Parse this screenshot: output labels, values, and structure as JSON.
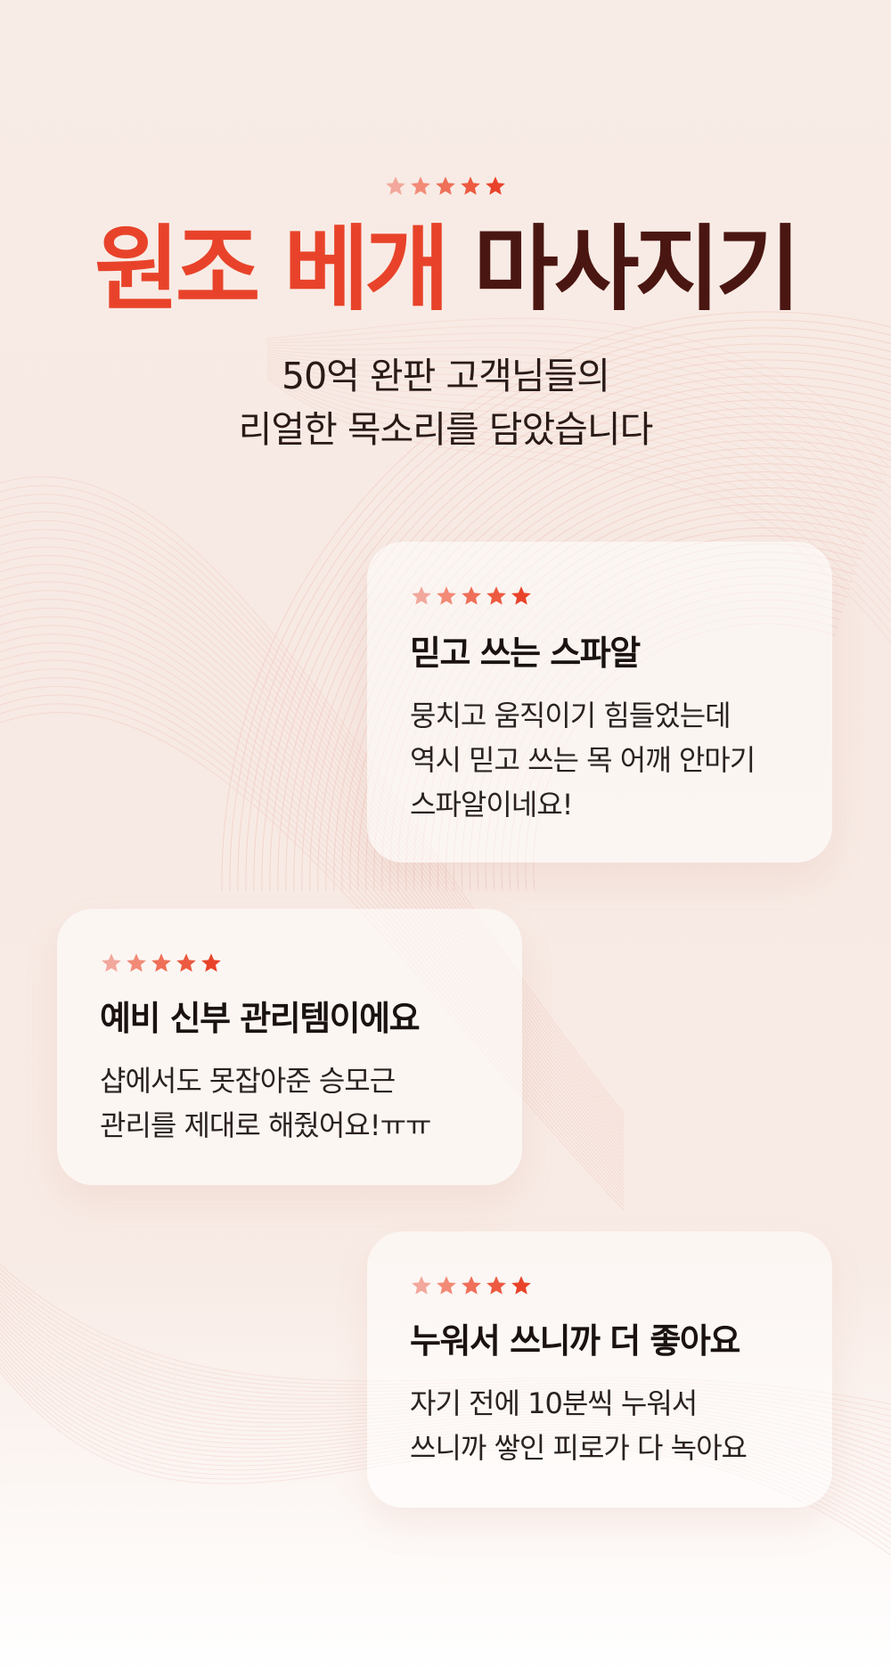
{
  "hero": {
    "headline_accent": "원조 베개",
    "headline_main": "마사지기",
    "subhead_line1": "50억 완판 고객님들의",
    "subhead_line2": "리얼한 목소리를 담았습니다"
  },
  "reviews": [
    {
      "rating": 5,
      "title": "믿고 쓰는 스파알",
      "lines": [
        "뭉치고 움직이기 힘들었는데",
        "역시 믿고 쓰는 목 어깨 안마기",
        "스파알이네요!"
      ]
    },
    {
      "rating": 5,
      "title": "예비 신부 관리템이에요",
      "lines": [
        "샵에서도 못잡아준 승모근",
        "관리를 제대로 해줬어요!ㅠㅠ"
      ]
    },
    {
      "rating": 5,
      "title": "누워서 쓰니까 더 좋아요",
      "lines": [
        "자기 전에 10분씩 누워서",
        "쓰니까 쌓인 피로가 다 녹아요"
      ]
    }
  ],
  "colors": {
    "accent": "#e8432a",
    "dark": "#4a1611",
    "star_gradient": [
      "#f2a89c",
      "#f28a76",
      "#ef6f58",
      "#ec5a40",
      "#e8432a"
    ]
  }
}
